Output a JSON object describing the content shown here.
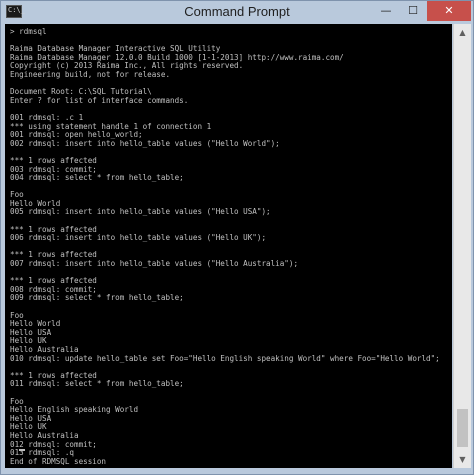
{
  "window": {
    "title": "Command Prompt",
    "icon_label": "C:\\_",
    "controls": {
      "minimize": "—",
      "maximize": "☐",
      "close": "✕"
    }
  },
  "console": {
    "lines": [
      "> rdmsql",
      "",
      "Raima Database Manager Interactive SQL Utility",
      "Raima Database Manager 12.0.0 Build 1000 [1-1-2013] http://www.raima.com/",
      "Copyright (c) 2013 Raima Inc., All rights reserved.",
      "Engineering build, not for release.",
      "",
      "Document Root: C:\\SQL Tutorial\\",
      "Enter ? for list of interface commands.",
      "",
      "001 rdmsql: .c 1",
      "*** using statement handle 1 of connection 1",
      "001 rdmsql: open hello_world;",
      "002 rdmsql: insert into hello_table values (\"Hello World\");",
      "",
      "*** 1 rows affected",
      "003 rdmsql: commit;",
      "004 rdmsql: select * from hello_table;",
      "",
      "Foo",
      "Hello World",
      "005 rdmsql: insert into hello_table values (\"Hello USA\");",
      "",
      "*** 1 rows affected",
      "006 rdmsql: insert into hello_table values (\"Hello UK\");",
      "",
      "*** 1 rows affected",
      "007 rdmsql: insert into hello_table values (\"Hello Australia\");",
      "",
      "*** 1 rows affected",
      "008 rdmsql: commit;",
      "009 rdmsql: select * from hello_table;",
      "",
      "Foo",
      "Hello World",
      "Hello USA",
      "Hello UK",
      "Hello Australia",
      "010 rdmsql: update hello_table set Foo=\"Hello English speaking World\" where Foo=\"Hello World\";",
      "",
      "*** 1 rows affected",
      "011 rdmsql: select * from hello_table;",
      "",
      "Foo",
      "Hello English speaking World",
      "Hello USA",
      "Hello UK",
      "Hello Australia",
      "012 rdmsql: commit;",
      "013 rdmsql: .q",
      "End of RDMSQL session",
      "",
      "> "
    ]
  },
  "scrollbar": {
    "up_arrow": "▲",
    "down_arrow": "▼",
    "position": 0.93
  }
}
